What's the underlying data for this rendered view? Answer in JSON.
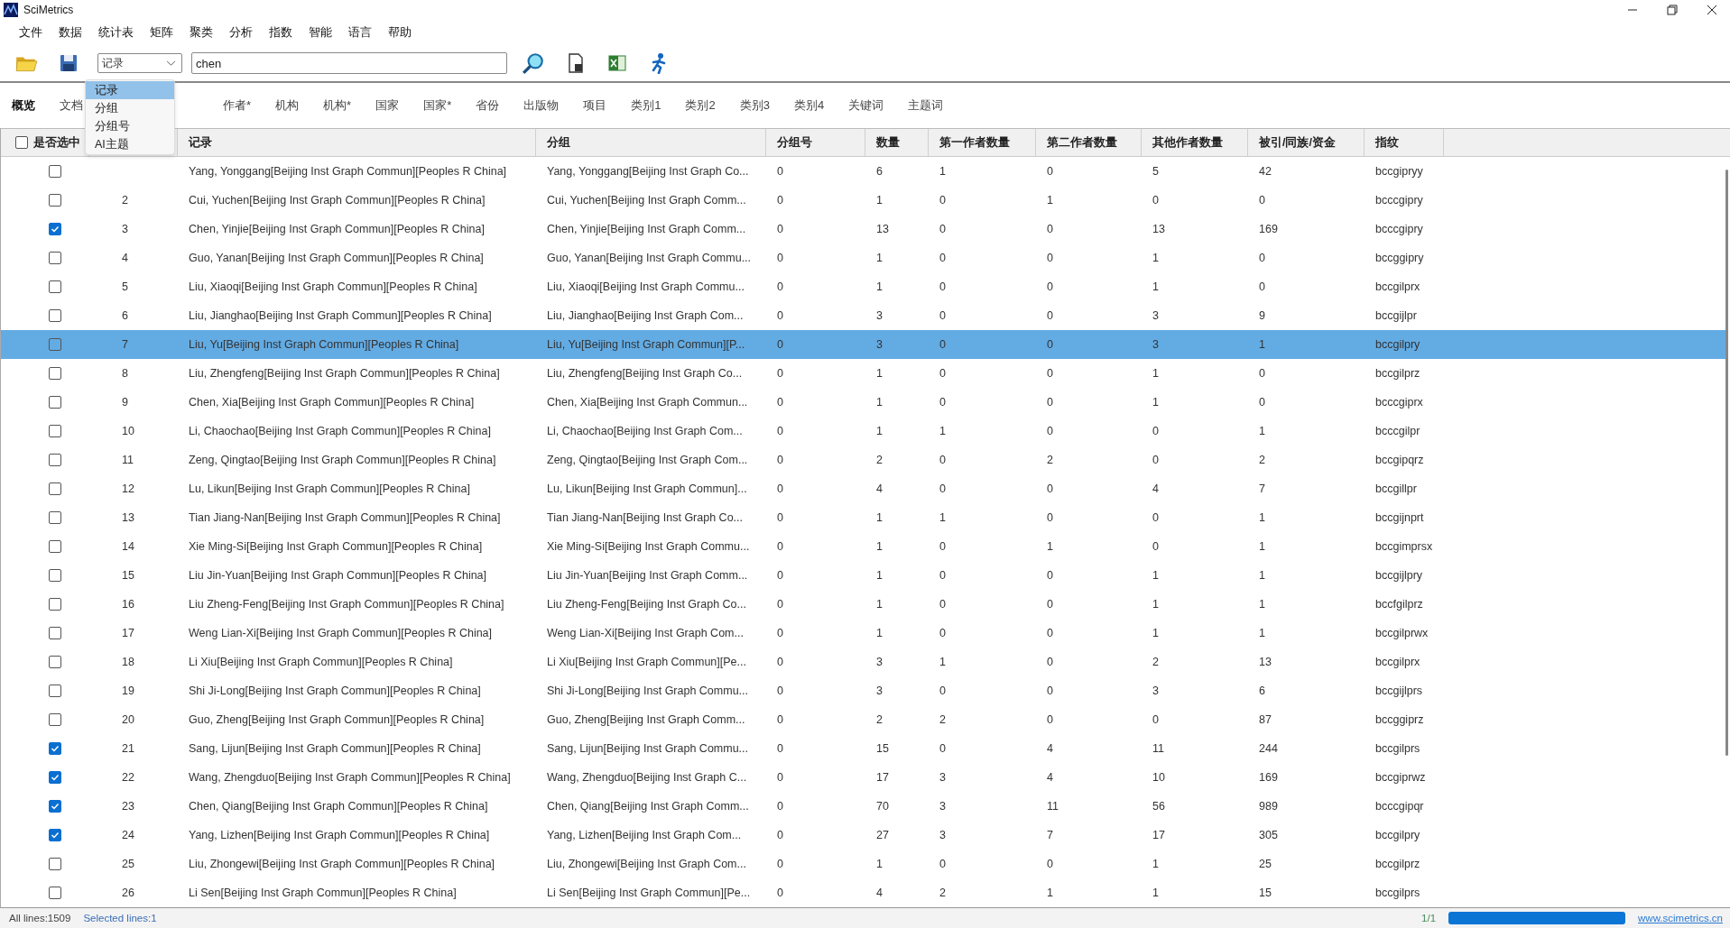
{
  "window": {
    "title": "SciMetrics"
  },
  "menu": [
    "文件",
    "数据",
    "统计表",
    "矩阵",
    "聚类",
    "分析",
    "指数",
    "智能",
    "语言",
    "帮助"
  ],
  "toolbar": {
    "select": {
      "value": "记录",
      "options": [
        {
          "label": "记录",
          "selected": true
        },
        {
          "label": "分组",
          "selected": false
        },
        {
          "label": "分组号",
          "selected": false
        },
        {
          "label": "AI主题",
          "selected": false
        }
      ]
    },
    "search": {
      "value": "chen"
    }
  },
  "tabs": [
    {
      "label": "概览",
      "selected": true
    },
    {
      "label": "文档",
      "selected": false
    },
    {
      "label": "作者*",
      "selected": false
    },
    {
      "label": "机构",
      "selected": false
    },
    {
      "label": "机构*",
      "selected": false
    },
    {
      "label": "国家",
      "selected": false
    },
    {
      "label": "国家*",
      "selected": false
    },
    {
      "label": "省份",
      "selected": false
    },
    {
      "label": "出版物",
      "selected": false
    },
    {
      "label": "项目",
      "selected": false
    },
    {
      "label": "类别1",
      "selected": false
    },
    {
      "label": "类别2",
      "selected": false
    },
    {
      "label": "类别3",
      "selected": false
    },
    {
      "label": "类别4",
      "selected": false
    },
    {
      "label": "关键词",
      "selected": false
    },
    {
      "label": "主题词",
      "selected": false
    }
  ],
  "table": {
    "select_all": {
      "label": "是否选中",
      "checked": false
    },
    "columns": [
      "记录",
      "分组",
      "分组号",
      "数量",
      "第一作者数量",
      "第二作者数量",
      "其他作者数量",
      "被引/同族/资金",
      "指纹"
    ],
    "rows": [
      {
        "checked": false,
        "selected": false,
        "cells": [
          "Yang, Yonggang[Beijing Inst Graph Commun][Peoples R China]",
          "Yang, Yonggang[Beijing Inst Graph Co...",
          "0",
          "6",
          "1",
          "0",
          "5",
          "42",
          "bccgipryy"
        ]
      },
      {
        "no": "2",
        "checked": false,
        "selected": false,
        "cells": [
          "Cui, Yuchen[Beijing Inst Graph Commun][Peoples R China]",
          "Cui, Yuchen[Beijing Inst Graph Comm...",
          "0",
          "1",
          "0",
          "1",
          "0",
          "0",
          "bcccgipry"
        ]
      },
      {
        "no": "3",
        "checked": true,
        "selected": false,
        "cells": [
          "Chen, Yinjie[Beijing Inst Graph Commun][Peoples R China]",
          "Chen, Yinjie[Beijing Inst Graph Comm...",
          "0",
          "13",
          "0",
          "0",
          "13",
          "169",
          "bcccgipry"
        ]
      },
      {
        "no": "4",
        "checked": false,
        "selected": false,
        "cells": [
          "Guo, Yanan[Beijing Inst Graph Commun][Peoples R China]",
          "Guo, Yanan[Beijing Inst Graph Commu...",
          "0",
          "1",
          "0",
          "0",
          "1",
          "0",
          "bccggipry"
        ]
      },
      {
        "no": "5",
        "checked": false,
        "selected": false,
        "cells": [
          "Liu, Xiaoqi[Beijing Inst Graph Commun][Peoples R China]",
          "Liu, Xiaoqi[Beijing Inst Graph Commu...",
          "0",
          "1",
          "0",
          "0",
          "1",
          "0",
          "bccgilprx"
        ]
      },
      {
        "no": "6",
        "checked": false,
        "selected": false,
        "cells": [
          "Liu, Jianghao[Beijing Inst Graph Commun][Peoples R China]",
          "Liu, Jianghao[Beijing Inst Graph Com...",
          "0",
          "3",
          "0",
          "0",
          "3",
          "9",
          "bccgijlpr"
        ]
      },
      {
        "no": "7",
        "checked": false,
        "selected": true,
        "cells": [
          "Liu, Yu[Beijing Inst Graph Commun][Peoples R China]",
          "Liu, Yu[Beijing Inst Graph Commun][P...",
          "0",
          "3",
          "0",
          "0",
          "3",
          "1",
          "bccgilpry"
        ]
      },
      {
        "no": "8",
        "checked": false,
        "selected": false,
        "cells": [
          "Liu, Zhengfeng[Beijing Inst Graph Commun][Peoples R China]",
          "Liu, Zhengfeng[Beijing Inst Graph Co...",
          "0",
          "1",
          "0",
          "0",
          "1",
          "0",
          "bccgilprz"
        ]
      },
      {
        "no": "9",
        "checked": false,
        "selected": false,
        "cells": [
          "Chen, Xia[Beijing Inst Graph Commun][Peoples R China]",
          "Chen, Xia[Beijing Inst Graph Commun...",
          "0",
          "1",
          "0",
          "0",
          "1",
          "0",
          "bcccgiprx"
        ]
      },
      {
        "no": "10",
        "checked": false,
        "selected": false,
        "cells": [
          "Li, Chaochao[Beijing Inst Graph Commun][Peoples R China]",
          "Li, Chaochao[Beijing Inst Graph Com...",
          "0",
          "1",
          "1",
          "0",
          "0",
          "1",
          "bcccgilpr"
        ]
      },
      {
        "no": "11",
        "checked": false,
        "selected": false,
        "cells": [
          "Zeng, Qingtao[Beijing Inst Graph Commun][Peoples R China]",
          "Zeng, Qingtao[Beijing Inst Graph Com...",
          "0",
          "2",
          "0",
          "2",
          "0",
          "2",
          "bccgipqrz"
        ]
      },
      {
        "no": "12",
        "checked": false,
        "selected": false,
        "cells": [
          "Lu, Likun[Beijing Inst Graph Commun][Peoples R China]",
          "Lu, Likun[Beijing Inst Graph Commun]...",
          "0",
          "4",
          "0",
          "0",
          "4",
          "7",
          "bccgillpr"
        ]
      },
      {
        "no": "13",
        "checked": false,
        "selected": false,
        "cells": [
          "Tian Jiang-Nan[Beijing Inst Graph Commun][Peoples R China]",
          "Tian Jiang-Nan[Beijing Inst Graph Co...",
          "0",
          "1",
          "1",
          "0",
          "0",
          "1",
          "bccgijnprt"
        ]
      },
      {
        "no": "14",
        "checked": false,
        "selected": false,
        "cells": [
          "Xie Ming-Si[Beijing Inst Graph Commun][Peoples R China]",
          "Xie Ming-Si[Beijing Inst Graph Commu...",
          "0",
          "1",
          "0",
          "1",
          "0",
          "1",
          "bccgimprsx"
        ]
      },
      {
        "no": "15",
        "checked": false,
        "selected": false,
        "cells": [
          "Liu Jin-Yuan[Beijing Inst Graph Commun][Peoples R China]",
          "Liu Jin-Yuan[Beijing Inst Graph Comm...",
          "0",
          "1",
          "0",
          "0",
          "1",
          "1",
          "bccgijlpry"
        ]
      },
      {
        "no": "16",
        "checked": false,
        "selected": false,
        "cells": [
          "Liu Zheng-Feng[Beijing Inst Graph Commun][Peoples R China]",
          "Liu Zheng-Feng[Beijing Inst Graph Co...",
          "0",
          "1",
          "0",
          "0",
          "1",
          "1",
          "bccfgilprz"
        ]
      },
      {
        "no": "17",
        "checked": false,
        "selected": false,
        "cells": [
          "Weng Lian-Xi[Beijing Inst Graph Commun][Peoples R China]",
          "Weng Lian-Xi[Beijing Inst Graph Com...",
          "0",
          "1",
          "0",
          "0",
          "1",
          "1",
          "bccgilprwx"
        ]
      },
      {
        "no": "18",
        "checked": false,
        "selected": false,
        "cells": [
          "Li Xiu[Beijing Inst Graph Commun][Peoples R China]",
          "Li Xiu[Beijing Inst Graph Commun][Pe...",
          "0",
          "3",
          "1",
          "0",
          "2",
          "13",
          "bccgilprx"
        ]
      },
      {
        "no": "19",
        "checked": false,
        "selected": false,
        "cells": [
          "Shi Ji-Long[Beijing Inst Graph Commun][Peoples R China]",
          "Shi Ji-Long[Beijing Inst Graph Commu...",
          "0",
          "3",
          "0",
          "0",
          "3",
          "6",
          "bccgijlprs"
        ]
      },
      {
        "no": "20",
        "checked": false,
        "selected": false,
        "cells": [
          "Guo, Zheng[Beijing Inst Graph Commun][Peoples R China]",
          "Guo, Zheng[Beijing Inst Graph Comm...",
          "0",
          "2",
          "2",
          "0",
          "0",
          "87",
          "bccggiprz"
        ]
      },
      {
        "no": "21",
        "checked": true,
        "selected": false,
        "cells": [
          "Sang, Lijun[Beijing Inst Graph Commun][Peoples R China]",
          "Sang, Lijun[Beijing Inst Graph Commu...",
          "0",
          "15",
          "0",
          "4",
          "11",
          "244",
          "bccgilprs"
        ]
      },
      {
        "no": "22",
        "checked": true,
        "selected": false,
        "cells": [
          "Wang, Zhengduo[Beijing Inst Graph Commun][Peoples R China]",
          "Wang, Zhengduo[Beijing Inst Graph C...",
          "0",
          "17",
          "3",
          "4",
          "10",
          "169",
          "bccgiprwz"
        ]
      },
      {
        "no": "23",
        "checked": true,
        "selected": false,
        "cells": [
          "Chen, Qiang[Beijing Inst Graph Commun][Peoples R China]",
          "Chen, Qiang[Beijing Inst Graph Comm...",
          "0",
          "70",
          "3",
          "11",
          "56",
          "989",
          "bcccgipqr"
        ]
      },
      {
        "no": "24",
        "checked": true,
        "selected": false,
        "cells": [
          "Yang, Lizhen[Beijing Inst Graph Commun][Peoples R China]",
          "Yang, Lizhen[Beijing Inst Graph Com...",
          "0",
          "27",
          "3",
          "7",
          "17",
          "305",
          "bccgilpry"
        ]
      },
      {
        "no": "25",
        "checked": false,
        "selected": false,
        "cells": [
          "Liu, Zhongewi[Beijing Inst Graph Commun][Peoples R China]",
          "Liu, Zhongewi[Beijing Inst Graph Com...",
          "0",
          "1",
          "0",
          "0",
          "1",
          "25",
          "bccgilprz"
        ]
      },
      {
        "no": "26",
        "checked": false,
        "selected": false,
        "cells": [
          "Li Sen[Beijing Inst Graph Commun][Peoples R China]",
          "Li Sen[Beijing Inst Graph Commun][Pe...",
          "0",
          "4",
          "2",
          "1",
          "1",
          "15",
          "bccgilprs"
        ]
      }
    ]
  },
  "status_bar": {
    "all_lines": "All lines:1509",
    "selected_lines": "Selected lines:1",
    "page": "1/1",
    "progress": {
      "level": 1
    },
    "link": "www.scimetrics.cn"
  }
}
